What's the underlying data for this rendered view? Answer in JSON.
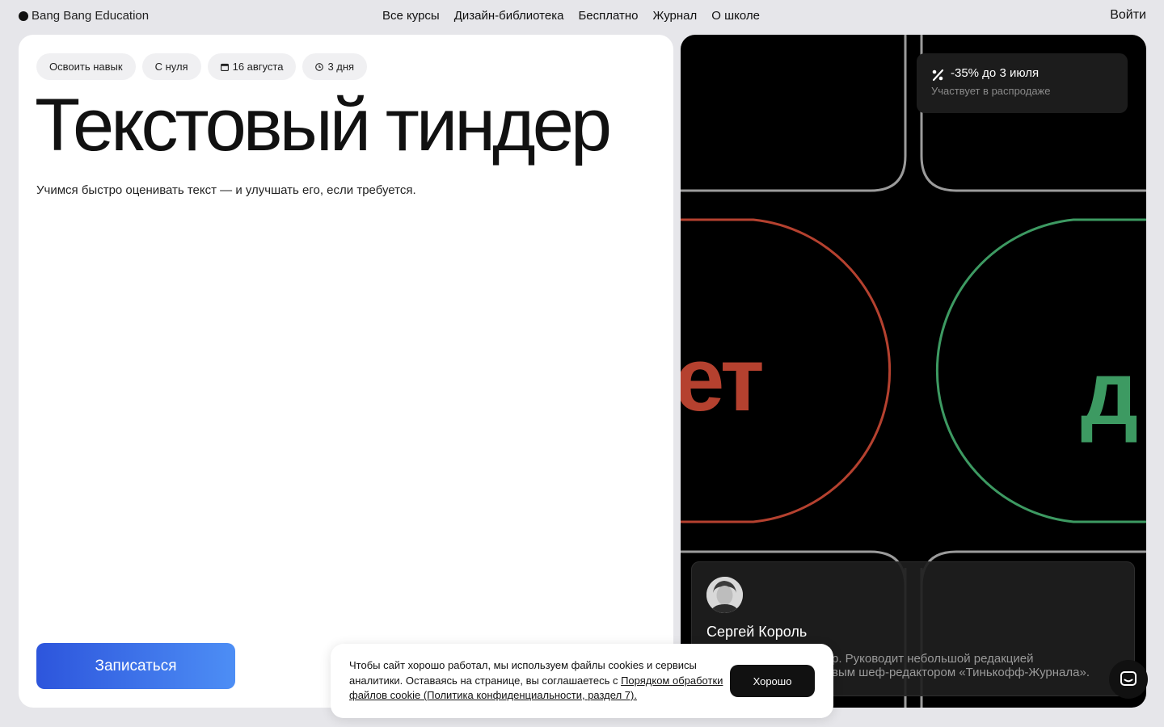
{
  "header": {
    "logo": "Bang Bang Education",
    "nav": [
      "Все курсы",
      "Дизайн-библиотека",
      "Бесплатно",
      "Журнал",
      "О школе"
    ],
    "login": "Войти"
  },
  "course": {
    "tags": {
      "skill": "Освоить навык",
      "level": "С нуля",
      "date": "16 августа",
      "duration": "3 дня"
    },
    "title": "Текстовый тиндер",
    "subtitle": "Учимся быстро оценивать текст — и улучшать его, если требуется.",
    "enroll": "Записаться"
  },
  "art": {
    "word_no": "ет",
    "word_yes": "д",
    "color_no": "#b5412f",
    "color_yes": "#3d9a62"
  },
  "sale": {
    "title": "-35% до 3 июля",
    "subtitle": "Участвует в распродаже"
  },
  "author": {
    "name": "Сергей Король",
    "bio_line1": "р. Руководит небольшой редакцией",
    "bio_line2": "вым шеф-редактором «Тинькофф-Журнала»."
  },
  "cookie": {
    "text": "Чтобы сайт хорошо работал, мы используем файлы cookies и сервисы аналитики. Оставаясь на странице, вы соглашаетесь с ",
    "link": "Порядком обработки файлов cookie (Политика конфиденциальности, раздел 7).",
    "button": "Хорошо"
  },
  "colors": {
    "accent_gradient_start": "#2d55dc",
    "accent_gradient_end": "#4d8ef5"
  }
}
